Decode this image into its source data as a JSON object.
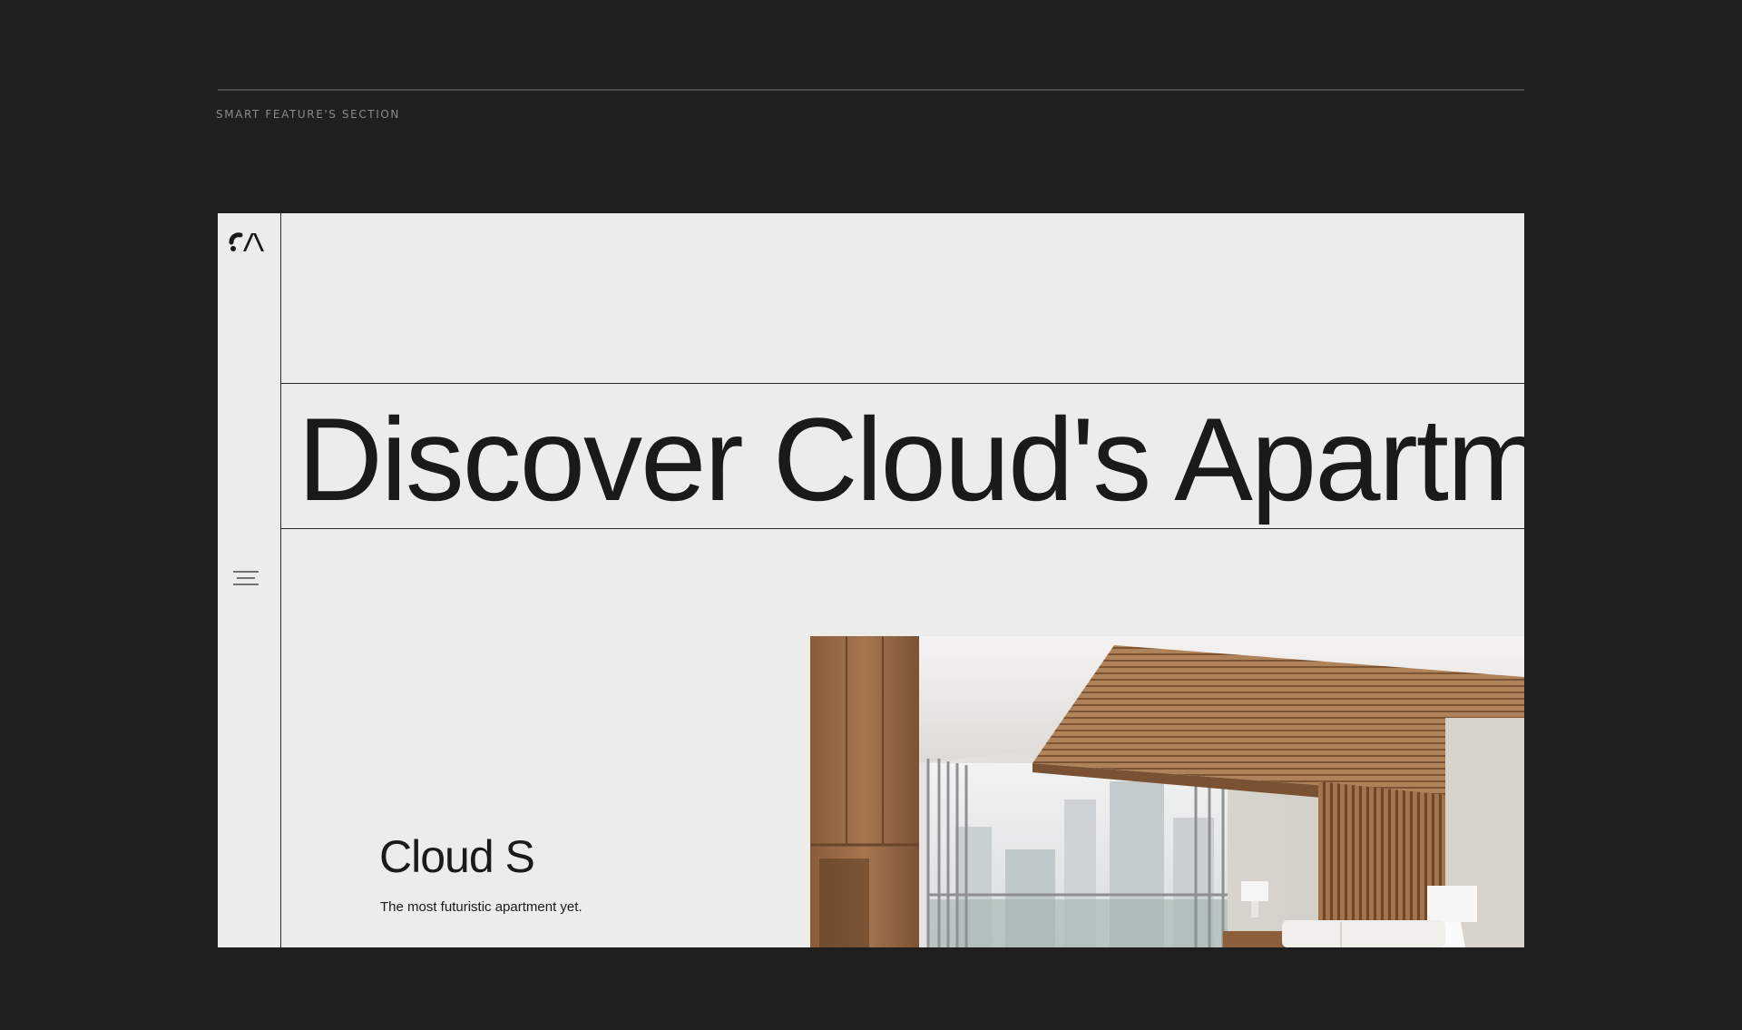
{
  "section": {
    "label": "SMART FEATURE'S SECTION"
  },
  "brand": {
    "logo_icon": "cloud-logo-icon"
  },
  "menu": {
    "icon": "hamburger-menu-icon"
  },
  "hero": {
    "headline": "Discover Cloud's Apartme"
  },
  "product": {
    "name": "Cloud S",
    "tagline": "The most futuristic apartment yet."
  },
  "image": {
    "subject": "apartment-interior-photo"
  },
  "colors": {
    "page_background": "#1f1f1f",
    "frame_background": "#ececea",
    "text": "#1a1a1a",
    "label": "#8a8a8a"
  }
}
